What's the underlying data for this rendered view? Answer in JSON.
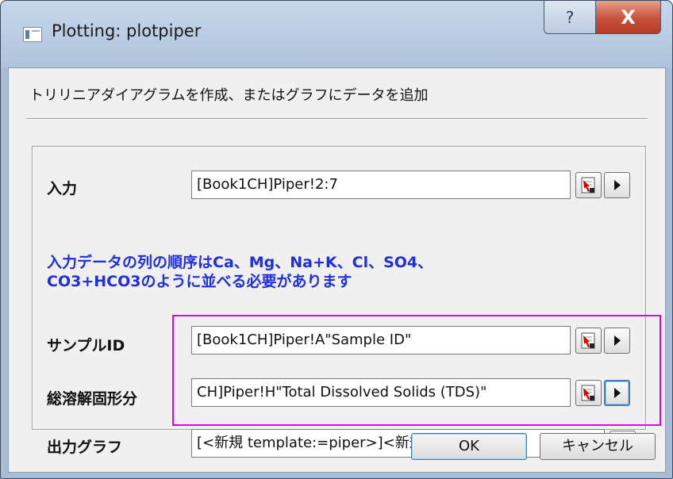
{
  "window": {
    "title": "Plotting: plotpiper",
    "help_label": "?",
    "close_label": "X"
  },
  "description": "トリリニアダイアグラムを作成、またはグラフにデータを追加",
  "fields": {
    "input": {
      "label": "入力",
      "value": "[Book1CH]Piper!2:7"
    },
    "sample_id": {
      "label": "サンプルID",
      "value": "[Book1CH]Piper!A\"Sample ID\""
    },
    "tds": {
      "label": "総溶解固形分",
      "value": "CH]Piper!H\"Total Dissolved Solids (TDS)\""
    },
    "output": {
      "label": "出力グラフ",
      "value": "[<新規 template:=piper>]<新規>"
    }
  },
  "info_note": {
    "line1": "入力データの列の順序はCa、Mg、Na+K、Cl、SO4、",
    "line2": "CO3+HCO3のように並べる必要があります"
  },
  "buttons": {
    "ok": "OK",
    "cancel": "キャンセル"
  },
  "colors": {
    "highlight": "#e000e0",
    "info_text": "#1f2fe0",
    "close": "#c8513a"
  },
  "icons": [
    "window-icon",
    "select-range-icon",
    "arrow-menu-icon"
  ]
}
